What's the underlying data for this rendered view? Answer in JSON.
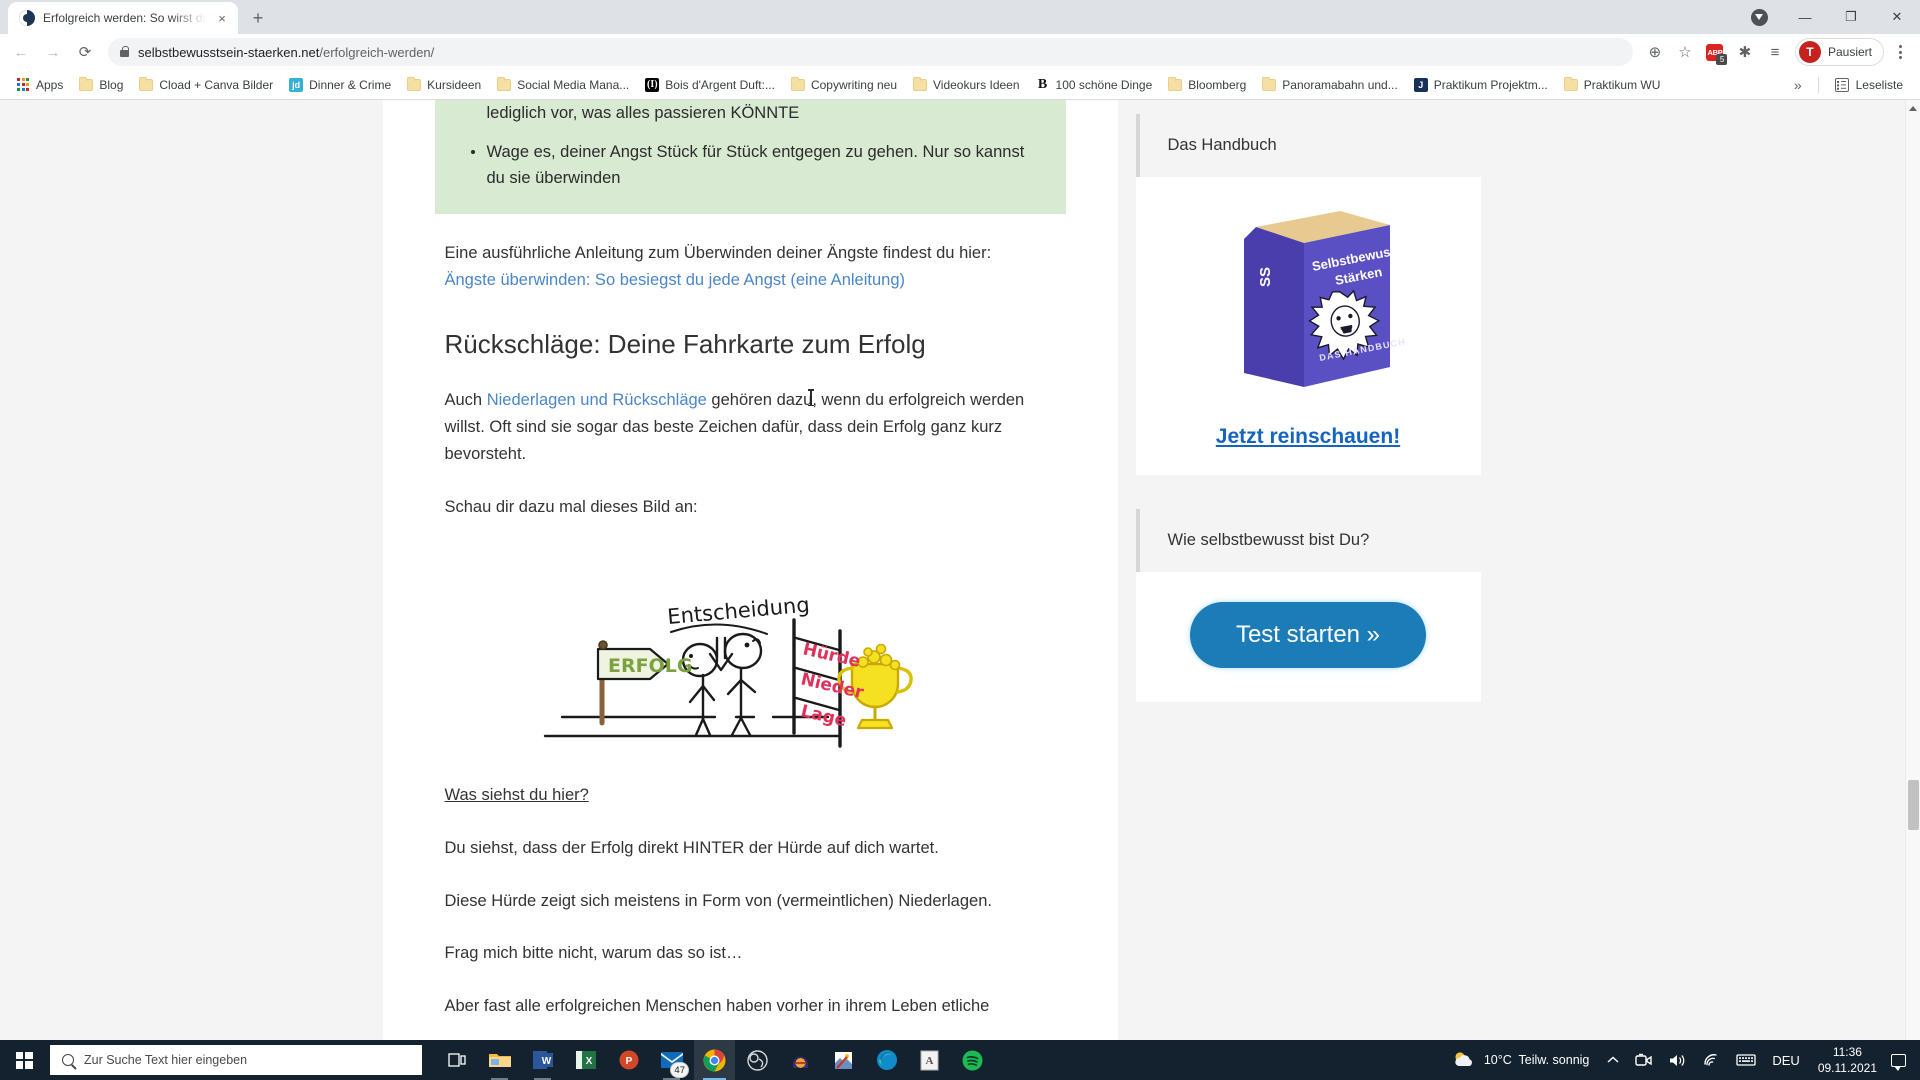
{
  "browser": {
    "tab": {
      "title": "Erfolgreich werden: So wirst du g",
      "favicon": "yin-yang-icon",
      "close": "×"
    },
    "new_tab_label": "+",
    "window_controls": {
      "minimize": "—",
      "maximize": "❐",
      "close": "✕"
    },
    "nav": {
      "back": "←",
      "forward": "→",
      "reload": "⟳"
    },
    "omnibox": {
      "domain": "selbstbewusstsein-staerken.net",
      "path": "/erfolgreich-werden/",
      "lock_icon": "lock-icon"
    },
    "toolbar_icons": {
      "zoom": "⊕",
      "bookmark_star": "☆",
      "adblock_label": "ABP",
      "adblock_badge": "5",
      "extensions": "✱",
      "reading_list": "≡"
    },
    "profile": {
      "initial": "T",
      "label": "Pausiert"
    },
    "menu": "kebab-menu",
    "bookmarks": [
      {
        "label": "Apps",
        "icon": "apps-grid-icon"
      },
      {
        "label": "Blog",
        "icon": "folder-icon"
      },
      {
        "label": "Cload + Canva Bilder",
        "icon": "folder-icon"
      },
      {
        "label": "Dinner & Crime",
        "icon": "jd-favicon"
      },
      {
        "label": "Kursideen",
        "icon": "folder-icon"
      },
      {
        "label": "Social Media Mana...",
        "icon": "folder-icon"
      },
      {
        "label": "Bois d'Argent Duft:...",
        "icon": "bois-favicon"
      },
      {
        "label": "Copywriting neu",
        "icon": "folder-icon"
      },
      {
        "label": "Videokurs Ideen",
        "icon": "folder-icon"
      },
      {
        "label": "100 schöne Dinge",
        "icon": "b-favicon"
      },
      {
        "label": "Bloomberg",
        "icon": "folder-icon"
      },
      {
        "label": "Panoramabahn und...",
        "icon": "folder-icon"
      },
      {
        "label": "Praktikum Projektm...",
        "icon": "j-favicon"
      },
      {
        "label": "Praktikum WU",
        "icon": "folder-icon"
      }
    ],
    "bookmarks_overflow": "»",
    "reading_list_label": "Leseliste"
  },
  "article": {
    "callout": {
      "trailing_text": "lediglich vor, was alles passieren KÖNNTE",
      "bullet": "Wage es, deiner Angst Stück für Stück entgegen zu gehen. Nur so kannst du sie überwinden"
    },
    "intro_paragraph": "Eine ausführliche Anleitung zum Überwinden deiner Ängste findest du hier:",
    "intro_link": "Ängste überwinden: So besiegst du jede Angst (eine Anleitung)",
    "heading": "Rückschläge: Deine Fahrkarte zum Erfolg",
    "para_auch_pre": "Auch ",
    "para_auch_link": "Niederlagen und Rückschläge",
    "para_auch_post": " gehören dazu, wenn du erfolgreich werden willst. Oft sind sie sogar das beste Zeichen dafür, dass dein Erfolg ganz kurz bevorsteht.",
    "para_schau": "Schau dir dazu mal dieses Bild an:",
    "illustration": {
      "alt": "Strichzeichnung: Entscheidung zwischen Erfolg und Hürde",
      "label_decision": "Entscheidung",
      "label_success": "ERFOLG",
      "label_hurdle_1": "Hürde",
      "label_hurdle_2": "Nieder",
      "label_hurdle_3": "Lage",
      "colors": {
        "success_text": "#7ba23f",
        "hurdle_text": "#e0315b",
        "trophy": "#f5e122",
        "post": "#8a6239"
      }
    },
    "question": "Was siehst du hier?",
    "para_hinter": "Du siehst, dass der Erfolg direkt HINTER der Hürde auf dich wartet.",
    "para_huerde": "Diese Hürde zeigt sich meistens in Form von (vermeintlichen) Niederlagen.",
    "para_frag": "Frag mich bitte nicht, warum das so ist…",
    "para_aber": "Aber fast alle erfolgreichen Menschen haben vorher in ihrem Leben etliche"
  },
  "sidebar": {
    "widgets": [
      {
        "title": "Das Handbuch",
        "book": {
          "title_line1": "Selbstbewusstsein",
          "title_line2": "Stärken",
          "subtitle": "DAS HANDBUCH",
          "spine": "SS",
          "cover_color": "#5b4fc4",
          "image_alt": "lion-head-icon"
        },
        "cta": "Jetzt reinschauen!"
      },
      {
        "title": "Wie selbstbewusst bist Du?",
        "button": "Test starten »",
        "button_color": "#1c7cb8"
      }
    ]
  },
  "taskbar": {
    "start": "windows-logo",
    "search_placeholder": "Zur Suche Text hier eingeben",
    "task_view": "task-view-icon",
    "items": [
      {
        "name": "file-explorer",
        "state": "open"
      },
      {
        "name": "word",
        "state": "open"
      },
      {
        "name": "excel",
        "state": "idle"
      },
      {
        "name": "powerpoint",
        "state": "idle"
      },
      {
        "name": "mail",
        "state": "open",
        "badge": "47"
      },
      {
        "name": "chrome",
        "state": "active"
      },
      {
        "name": "obs-studio",
        "state": "idle"
      },
      {
        "name": "audio-app",
        "state": "idle"
      },
      {
        "name": "photo-editor",
        "state": "idle"
      },
      {
        "name": "edge",
        "state": "idle"
      },
      {
        "name": "notes-app",
        "state": "idle"
      },
      {
        "name": "spotify",
        "state": "idle"
      }
    ],
    "tray": {
      "weather_temp": "10°C",
      "weather_desc": "Teilw. sonnig",
      "chevron": "⌃",
      "camera": "camera-icon",
      "volume": "volume-icon",
      "network": "wifi-icon",
      "keyboard": "keyboard-icon",
      "language": "DEU",
      "time": "11:36",
      "date": "09.11.2021",
      "notifications": "notification-icon"
    }
  }
}
